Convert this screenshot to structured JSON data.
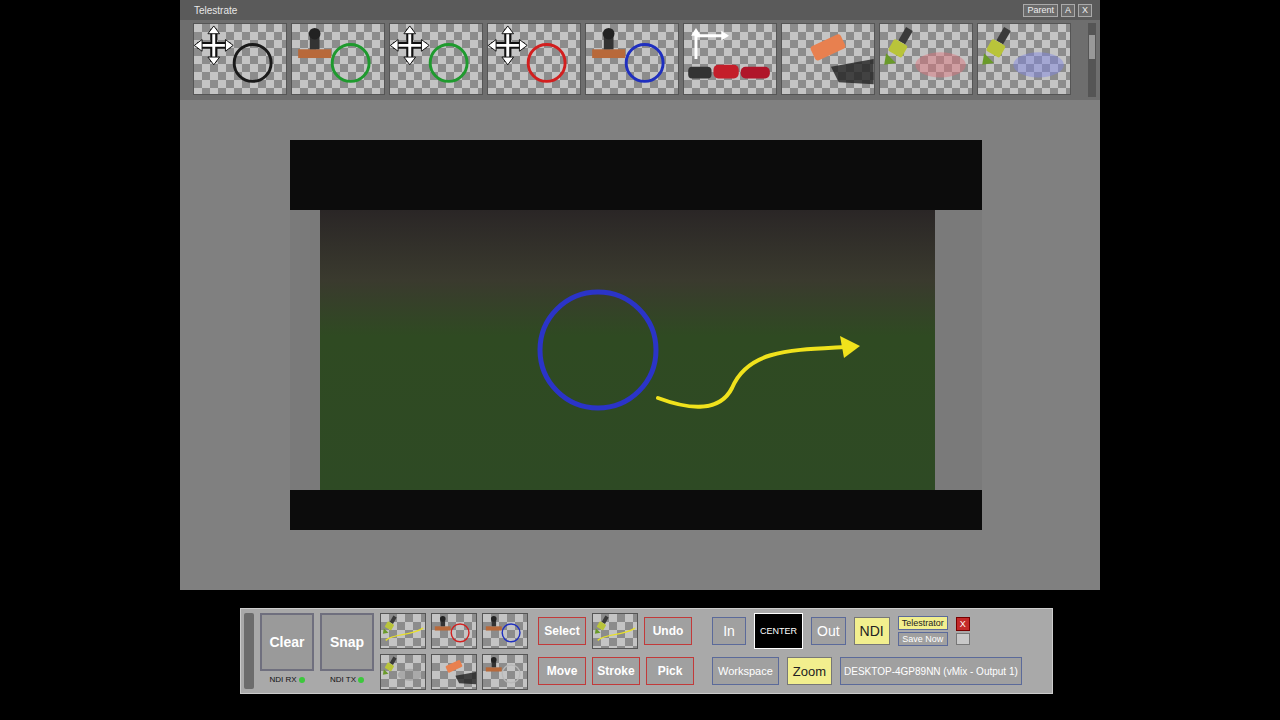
{
  "window": {
    "title": "Telestrate",
    "buttons": [
      "Parent",
      "A",
      "X"
    ]
  },
  "toolbar": [
    {
      "kind": "move-circle",
      "color": "#1a1a1a"
    },
    {
      "kind": "stamp-circle",
      "color": "#1f9a2e"
    },
    {
      "kind": "move-circle",
      "color": "#1f9a2e"
    },
    {
      "kind": "move-circle",
      "color": "#d21f1f"
    },
    {
      "kind": "stamp-circle",
      "color": "#1f2fbf"
    },
    {
      "kind": "path",
      "color": "#c41e2a"
    },
    {
      "kind": "eraser",
      "color": "#e8804f"
    },
    {
      "kind": "brush",
      "color": "#e0707a"
    },
    {
      "kind": "brush",
      "color": "#7f86e6"
    }
  ],
  "annotations": [
    {
      "kind": "circle",
      "color": "#2b34c8"
    },
    {
      "kind": "arrow",
      "color": "#f0e21c"
    }
  ],
  "panel": {
    "main_buttons": [
      {
        "label": "Clear",
        "status": "NDI RX",
        "status_on": true
      },
      {
        "label": "Snap",
        "status": "NDI TX",
        "status_on": true
      }
    ],
    "mini_tools": [
      {
        "kind": "brush-line",
        "color": "#e8e02a"
      },
      {
        "kind": "stamp-circle",
        "color": "#d21f1f"
      },
      {
        "kind": "stamp-circle",
        "color": "#1f2fbf"
      },
      {
        "kind": "brush",
        "color": "#8a8a8a"
      },
      {
        "kind": "eraser",
        "color": "#e8804f"
      },
      {
        "kind": "stamp-circle",
        "color": "#b8b8b8"
      }
    ],
    "current_tool": {
      "kind": "brush-line",
      "color": "#e8e02a"
    },
    "actions_top": [
      "Select",
      "Undo"
    ],
    "actions_bottom": [
      "Move",
      "Stroke",
      "Pick"
    ],
    "zoom_buttons": [
      {
        "label": "In",
        "active": false,
        "kind": "plain"
      },
      {
        "label": "CENTER",
        "active": false,
        "kind": "dark"
      },
      {
        "label": "Out",
        "active": false,
        "kind": "plain"
      },
      {
        "label": "NDI",
        "active": true,
        "kind": "plain"
      }
    ],
    "telestrator": {
      "label": "Telestrator",
      "active": true
    },
    "save_now": "Save Now",
    "close": "X",
    "workspace": {
      "label": "Workspace",
      "active": false
    },
    "zoom": {
      "label": "Zoom",
      "active": true
    },
    "output": "DESKTOP-4GP89NN (vMix - Output 1)"
  }
}
